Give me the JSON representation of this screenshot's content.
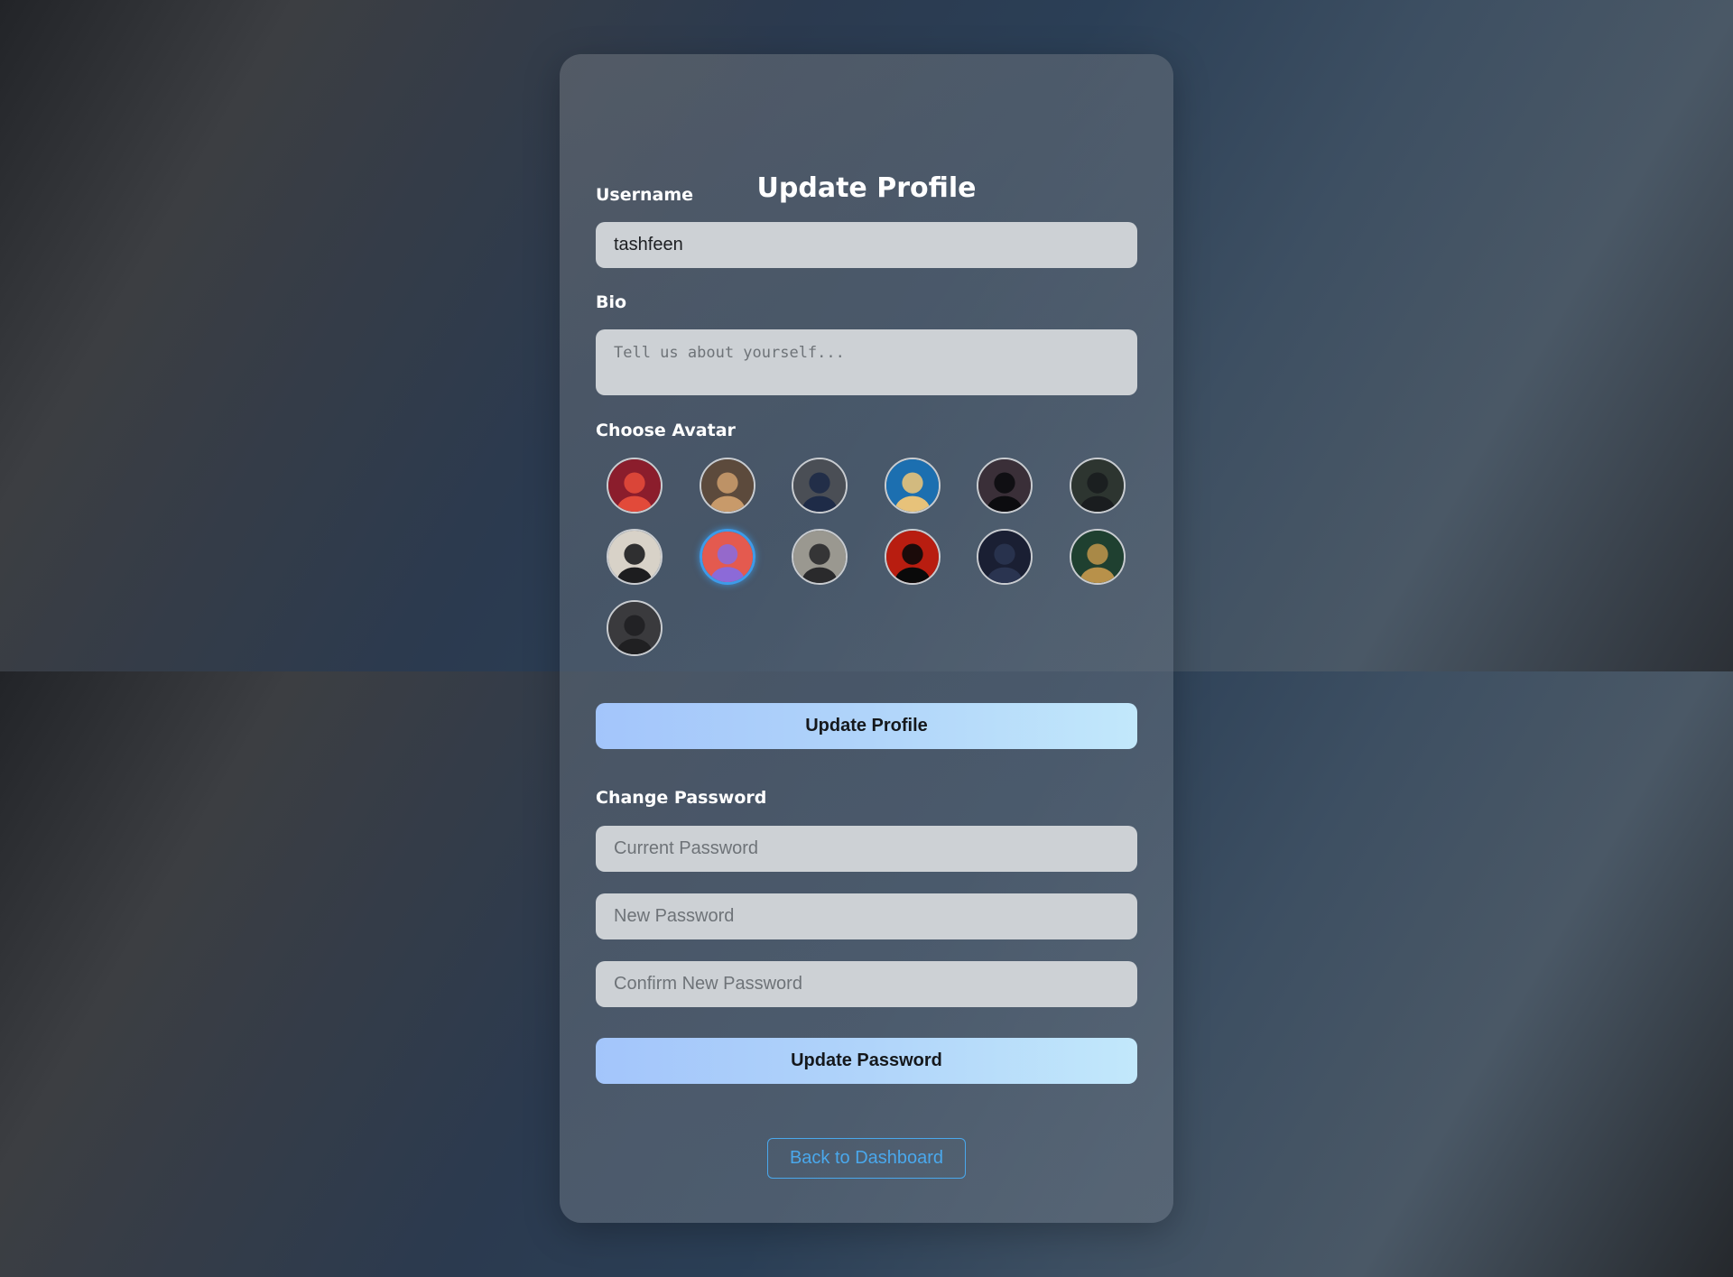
{
  "profile": {
    "title": "Update Profile",
    "username_label": "Username",
    "username_value": "tashfeen",
    "bio_label": "Bio",
    "bio_value": "",
    "bio_placeholder": "Tell us about yourself...",
    "avatar_label": "Choose Avatar",
    "avatars": [
      {
        "name": "avatar-1",
        "bg": "#8b1d2c",
        "fg": "#e24a3a",
        "selected": false
      },
      {
        "name": "avatar-2",
        "bg": "#5c4a3c",
        "fg": "#c89a6a",
        "selected": false
      },
      {
        "name": "avatar-3",
        "bg": "#4a4e55",
        "fg": "#1e2b47",
        "selected": false
      },
      {
        "name": "avatar-4",
        "bg": "#1c6fb0",
        "fg": "#e7c27a",
        "selected": false
      },
      {
        "name": "avatar-5",
        "bg": "#3a2f38",
        "fg": "#0c0c0f",
        "selected": false
      },
      {
        "name": "avatar-6",
        "bg": "#2d3530",
        "fg": "#1a1d1f",
        "selected": false
      },
      {
        "name": "avatar-7",
        "bg": "#d8d2c8",
        "fg": "#1d1d1f",
        "selected": false
      },
      {
        "name": "avatar-8",
        "bg": "#e45a4f",
        "fg": "#8c6ad8",
        "selected": true
      },
      {
        "name": "avatar-9",
        "bg": "#9a9890",
        "fg": "#2a2a2c",
        "selected": false
      },
      {
        "name": "avatar-10",
        "bg": "#b81d10",
        "fg": "#0a0a0a",
        "selected": false
      },
      {
        "name": "avatar-11",
        "bg": "#1a1f33",
        "fg": "#2a3450",
        "selected": false
      },
      {
        "name": "avatar-12",
        "bg": "#1f4030",
        "fg": "#b8914a",
        "selected": false
      },
      {
        "name": "avatar-13",
        "bg": "#3a3a3d",
        "fg": "#202022",
        "selected": false
      }
    ],
    "update_button": "Update Profile"
  },
  "password": {
    "section_label": "Change Password",
    "current_placeholder": "Current Password",
    "new_placeholder": "New Password",
    "confirm_placeholder": "Confirm New Password",
    "update_button": "Update Password"
  },
  "back_button": "Back to Dashboard",
  "colors": {
    "accent": "#4aa8ec",
    "button_gradient_start": "#a3c5fb",
    "button_gradient_end": "#c2e8fb",
    "field_bg": "#cdd1d5",
    "selected_ring": "#3d9be9"
  }
}
